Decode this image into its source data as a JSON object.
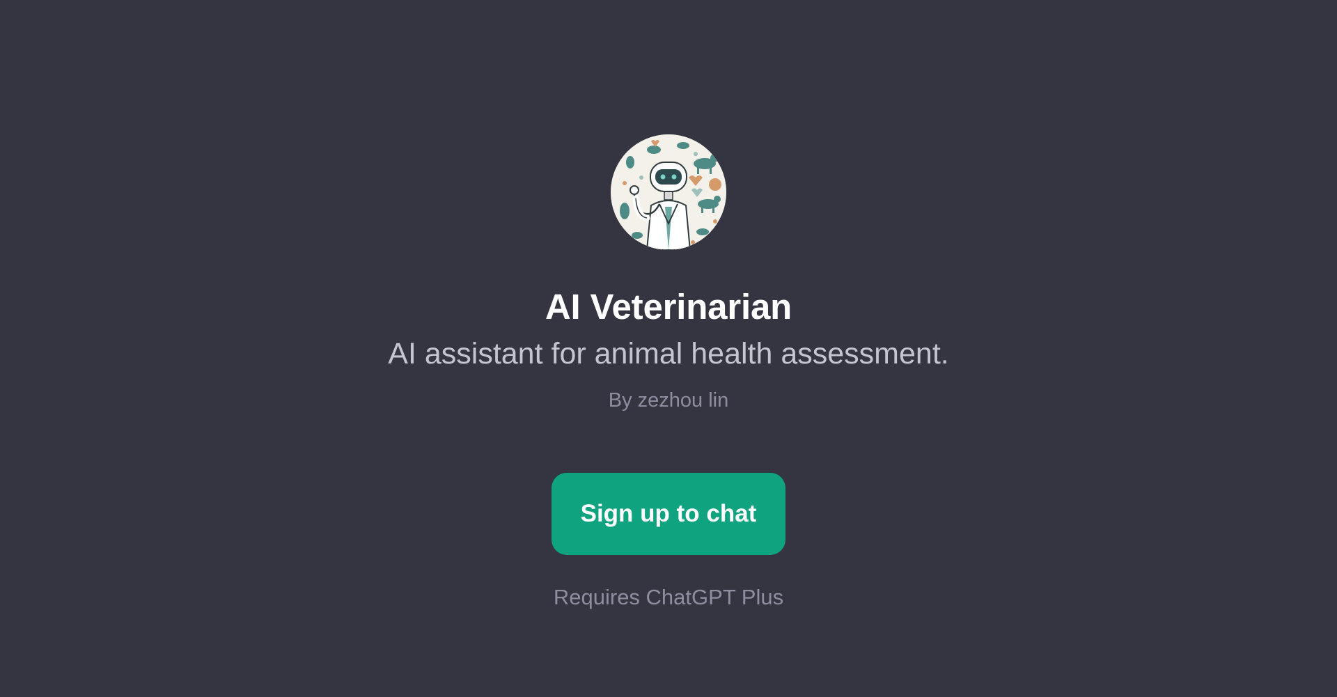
{
  "gpt": {
    "avatar_icon": "robot-veterinarian-avatar",
    "title": "AI Veterinarian",
    "description": "AI assistant for animal health assessment.",
    "author": "By zezhou lin"
  },
  "actions": {
    "signup_label": "Sign up to chat"
  },
  "footer": {
    "requirement": "Requires ChatGPT Plus"
  },
  "colors": {
    "background": "#343541",
    "button": "#10a37f",
    "subtitle": "#c5c5d2",
    "muted": "#8e8ea0"
  }
}
